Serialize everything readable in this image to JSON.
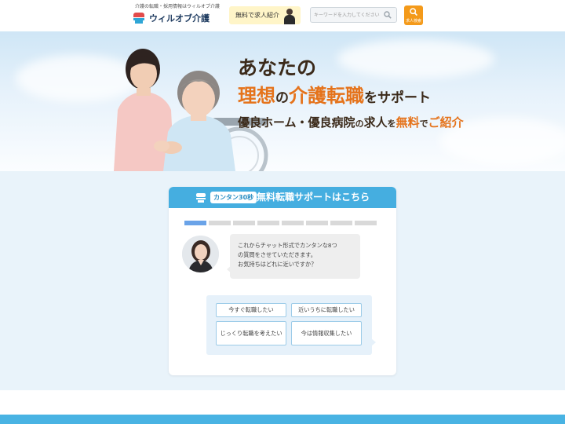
{
  "header": {
    "tagline": "介護の転職・採用情報はウィルオブ介護",
    "logo_text": "ウィルオブ介護",
    "free_intro_label": "無料で求人紹介",
    "search_placeholder": "キーワードを入力してください",
    "job_search_label": "求人検索"
  },
  "hero": {
    "line1": "あなたの",
    "line2_a": "理想",
    "line2_b": "の",
    "line2_c": "介護転職",
    "line2_d": "をサポート",
    "line3_a": "優良ホーム・優良病院",
    "line3_b": "の",
    "line3_c": "求人",
    "line3_d": "を",
    "line3_e": "無料",
    "line3_f": "で",
    "line3_g": "ご紹介"
  },
  "chat": {
    "badge": "カンタン30秒",
    "title": "無料転職サポートはこちら",
    "progress_total": 8,
    "progress_current": 1,
    "message_lines": [
      "これからチャット形式でカンタンな8つ",
      "の質問をさせていただきます。",
      "お気持ちはどれに近いですか？"
    ],
    "options": [
      "今すぐ転職したい",
      "近いうちに転職したい",
      "じっくり転職を考えたい",
      "今は情報収集したい"
    ]
  },
  "colors": {
    "accent_blue": "#45aee0",
    "accent_orange": "#e5731b",
    "button_orange": "#f49a1a",
    "free_button_bg": "#fff5c8",
    "progress_active": "#6aa3e8"
  }
}
